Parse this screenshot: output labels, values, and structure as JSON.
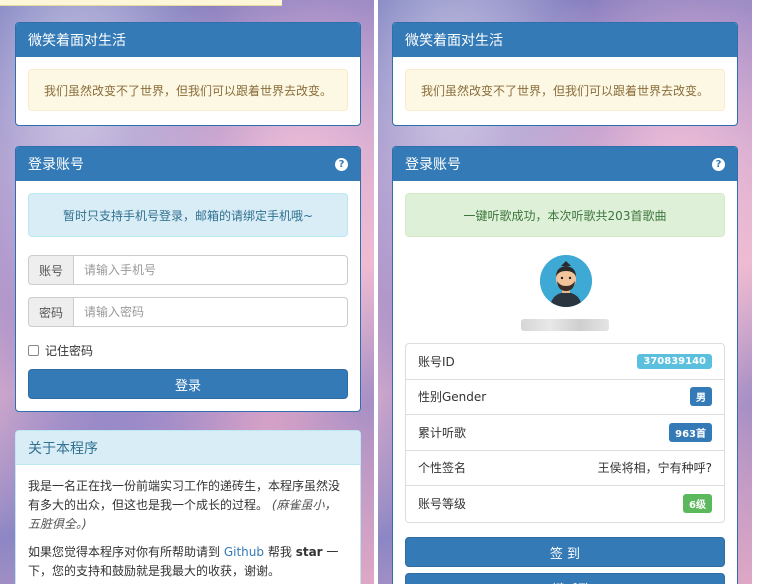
{
  "left": {
    "motto_panel": {
      "title": "微笑着面对生活",
      "quote": "我们虽然改变不了世界，但我们可以跟着世界去改变。"
    },
    "login_panel": {
      "title": "登录账号",
      "help_icon": "question-circle-icon",
      "notice": "暂时只支持手机号登录，邮箱的请绑定手机哦~",
      "account_label": "账号",
      "account_placeholder": "请输入手机号",
      "password_label": "密码",
      "password_placeholder": "请输入密码",
      "remember_label": "记住密码",
      "login_button": "登录"
    },
    "about_panel": {
      "title": "关于本程序",
      "para1_main": "我是一名正在找一份前端实习工作的递砖生，本程序虽然没有多大的出众，但这也是我一个成长的过程。",
      "para1_em": "(麻雀虽小，五脏俱全。)",
      "para2_a": "如果您觉得本程序对你有所帮助请到",
      "para2_link": "Github",
      "para2_b": "帮我",
      "para2_strong": "star",
      "para2_c": "一下，您的支持和鼓励就是我最大的收获，谢谢。"
    }
  },
  "right": {
    "motto_panel": {
      "title": "微笑着面对生活",
      "quote": "我们虽然改变不了世界，但我们可以跟着世界去改变。"
    },
    "account_panel": {
      "title": "登录账号",
      "help_icon": "question-circle-icon",
      "success_message": "一键听歌成功，本次听歌共203首歌曲",
      "rows": [
        {
          "label": "账号ID",
          "value": "370839140",
          "badge": "info"
        },
        {
          "label": "性别Gender",
          "value": "男",
          "badge": "primary"
        },
        {
          "label": "累计听歌",
          "value": "963首",
          "badge": "primary"
        },
        {
          "label": "个性签名",
          "value": "王侯将相，宁有种呼?",
          "badge": "none"
        },
        {
          "label": "账号等级",
          "value": "6级",
          "badge": "success"
        }
      ],
      "signin_button": "签 到",
      "listen_button": "一键听歌"
    }
  },
  "colors": {
    "primary": "#337ab7",
    "info_badge": "#5bc0de",
    "success_badge": "#5cb85c"
  }
}
